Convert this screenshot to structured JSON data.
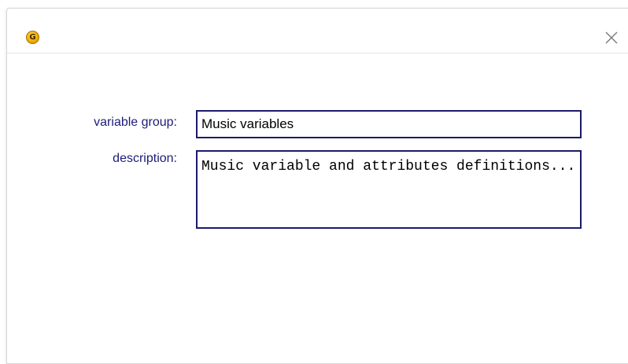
{
  "window": {
    "app_icon_letter": "G",
    "close_icon": "close-icon"
  },
  "form": {
    "group_label": "variable group:",
    "group_value": "Music variables",
    "description_label": "description:",
    "description_value": "Music variable and attributes definitions..."
  },
  "colors": {
    "label_text": "#1c1c7a",
    "input_border": "#1a1a6a",
    "app_icon": "#f0a800"
  }
}
